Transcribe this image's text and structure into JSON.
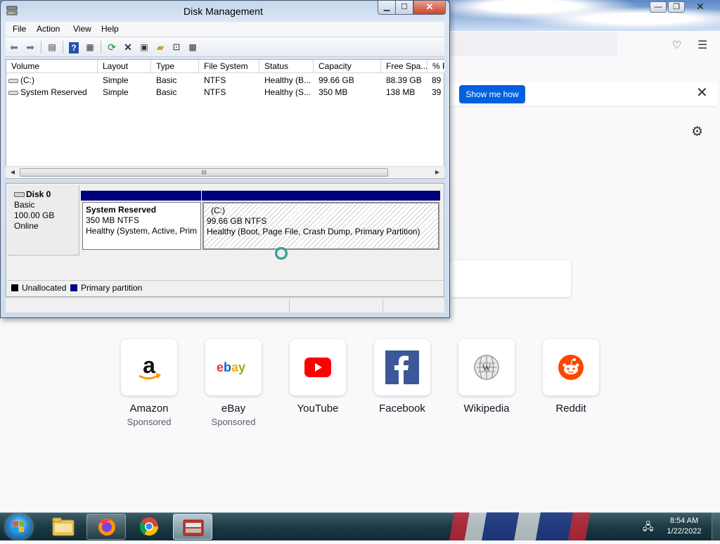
{
  "disk_mgmt": {
    "title": "Disk Management",
    "menu": [
      "File",
      "Action",
      "View",
      "Help"
    ],
    "columns": [
      "Volume",
      "Layout",
      "Type",
      "File System",
      "Status",
      "Capacity",
      "Free Spa...",
      "% F"
    ],
    "rows": [
      [
        "(C:)",
        "Simple",
        "Basic",
        "NTFS",
        "Healthy (B...",
        "99.66 GB",
        "88.39 GB",
        "89"
      ],
      [
        "System Reserved",
        "Simple",
        "Basic",
        "NTFS",
        "Healthy (S...",
        "350 MB",
        "138 MB",
        "39"
      ]
    ],
    "scroll_grip": "III",
    "disk": {
      "name": "Disk 0",
      "type": "Basic",
      "size": "100.00 GB",
      "state": "Online"
    },
    "partitions": [
      {
        "name": "System Reserved",
        "size": "350 MB NTFS",
        "status": "Healthy (System, Active, Prim"
      },
      {
        "name": "(C:)",
        "size": "99.66 GB NTFS",
        "status": "Healthy (Boot, Page File, Crash Dump, Primary Partition)"
      }
    ],
    "legend": [
      {
        "label": "Unallocated",
        "color": "#000000"
      },
      {
        "label": "Primary partition",
        "color": "#00007c"
      }
    ],
    "accent_color": "#00007c"
  },
  "firefox": {
    "notice_button": "Show me how",
    "shortcuts": [
      {
        "name": "Amazon",
        "sub": "Sponsored",
        "icon": "amazon-icon"
      },
      {
        "name": "eBay",
        "sub": "Sponsored",
        "icon": "ebay-icon"
      },
      {
        "name": "YouTube",
        "sub": "",
        "icon": "youtube-icon"
      },
      {
        "name": "Facebook",
        "sub": "",
        "icon": "facebook-icon"
      },
      {
        "name": "Wikipedia",
        "sub": "",
        "icon": "wikipedia-icon"
      },
      {
        "name": "Reddit",
        "sub": "",
        "icon": "reddit-icon"
      }
    ]
  },
  "taskbar": {
    "time": "8:54 AM",
    "date": "1/22/2022",
    "apps": [
      "explorer-icon",
      "firefox-icon",
      "chrome-icon",
      "computer-management-icon"
    ]
  }
}
